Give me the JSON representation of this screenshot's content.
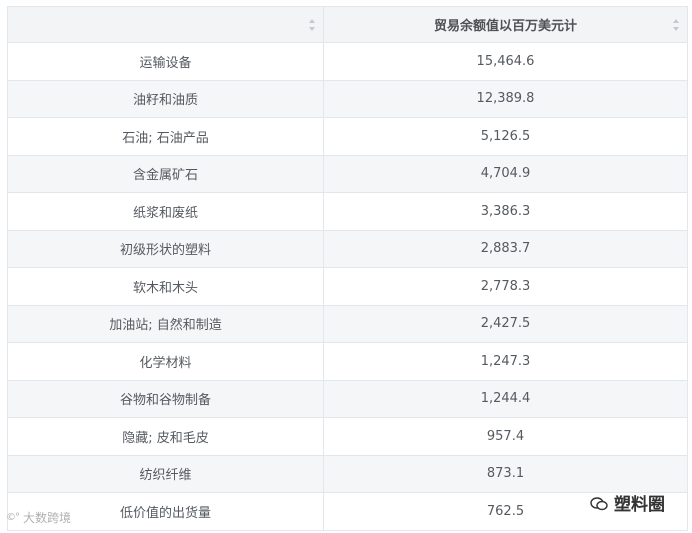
{
  "table": {
    "header": {
      "col1": "",
      "col2": "贸易余额值以百万美元计"
    },
    "rows": [
      {
        "category": "运输设备",
        "value": "15,464.6"
      },
      {
        "category": "油籽和油质",
        "value": "12,389.8"
      },
      {
        "category": "石油; 石油产品",
        "value": "5,126.5"
      },
      {
        "category": "含金属矿石",
        "value": "4,704.9"
      },
      {
        "category": "纸浆和废纸",
        "value": "3,386.3"
      },
      {
        "category": "初级形状的塑料",
        "value": "2,883.7"
      },
      {
        "category": "软木和木头",
        "value": "2,778.3"
      },
      {
        "category": "加油站; 自然和制造",
        "value": "2,427.5"
      },
      {
        "category": "化学材料",
        "value": "1,247.3"
      },
      {
        "category": "谷物和谷物制备",
        "value": "1,244.4"
      },
      {
        "category": "隐藏; 皮和毛皮",
        "value": "957.4"
      },
      {
        "category": "纺织纤维",
        "value": "873.1"
      },
      {
        "category": "低价值的出货量",
        "value": "762.5"
      }
    ]
  },
  "watermarks": {
    "left_logo": "©°",
    "left_text": "大数跨境",
    "right_icon": "wechat-icon",
    "right_text": "塑料圈"
  }
}
